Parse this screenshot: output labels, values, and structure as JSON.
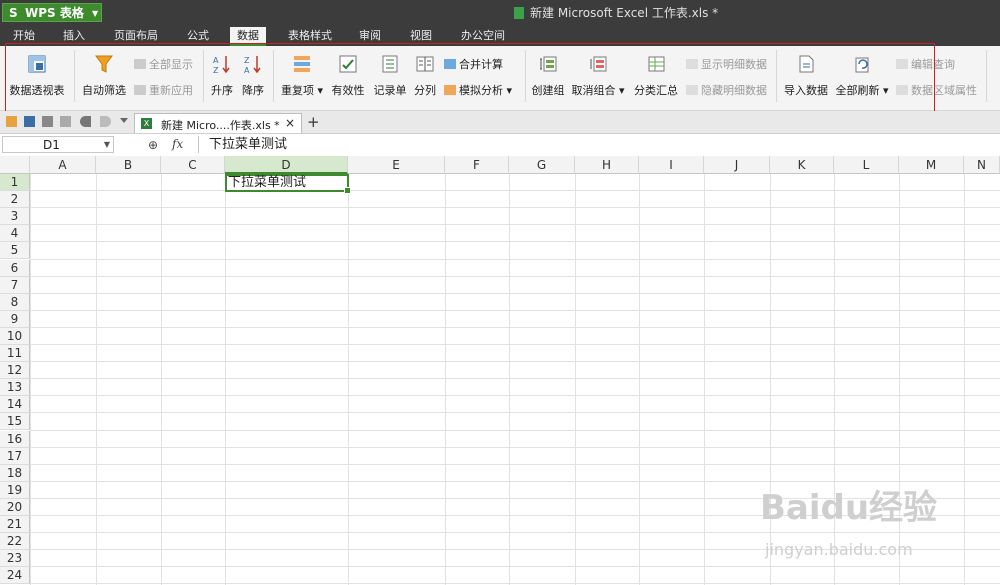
{
  "app": {
    "logo": "S",
    "name": "WPS 表格",
    "menu_arrow": "▼"
  },
  "document_title": "新建 Microsoft Excel 工作表.xls *",
  "menu_tabs": [
    "开始",
    "插入",
    "页面布局",
    "公式",
    "数据",
    "表格样式",
    "审阅",
    "视图",
    "办公空间"
  ],
  "active_menu_tab": "数据",
  "ribbon": {
    "pivot_table": "数据透视表",
    "auto_filter": "自动筛选",
    "show_all": "全部显示",
    "reapply": "重新应用",
    "sort_asc": "升序",
    "sort_desc": "降序",
    "duplicates": "重复项",
    "validity": "有效性",
    "record_form": "记录单",
    "text_to_columns": "分列",
    "consolidate": "合并计算",
    "what_if": "模拟分析",
    "group": "创建组",
    "ungroup": "取消组合",
    "subtotal": "分类汇总",
    "show_detail": "显示明细数据",
    "hide_detail": "隐藏明细数据",
    "import_data": "导入数据",
    "refresh_all": "全部刷新",
    "edit_query": "编辑查询",
    "range_properties": "数据区域属性"
  },
  "doc_tab": {
    "icon_label": "X",
    "label": "新建 Micro....作表.xls *",
    "close": "×",
    "new_tab": "+"
  },
  "formula_bar": {
    "name_box": "D1",
    "fx": "fx",
    "content": "下拉菜单测试"
  },
  "sheet": {
    "columns": [
      "A",
      "B",
      "C",
      "D",
      "E",
      "F",
      "G",
      "H",
      "I",
      "J",
      "K",
      "L",
      "M",
      "N"
    ],
    "rows": [
      "1",
      "2",
      "3",
      "4",
      "5",
      "6",
      "7",
      "8",
      "9",
      "10",
      "11",
      "12",
      "13",
      "14",
      "15",
      "16",
      "17",
      "18",
      "19",
      "20",
      "21",
      "22",
      "23",
      "24"
    ],
    "selected_column": "D",
    "selected_row": "1",
    "active_cell_value": "下拉菜单测试"
  },
  "watermark": {
    "brand": "Baidu经验",
    "url": "jingyan.baidu.com"
  },
  "colors": {
    "accent": "#3e8b2e",
    "highlight": "#cc1f1f",
    "titlebar": "#3c3c3c"
  }
}
